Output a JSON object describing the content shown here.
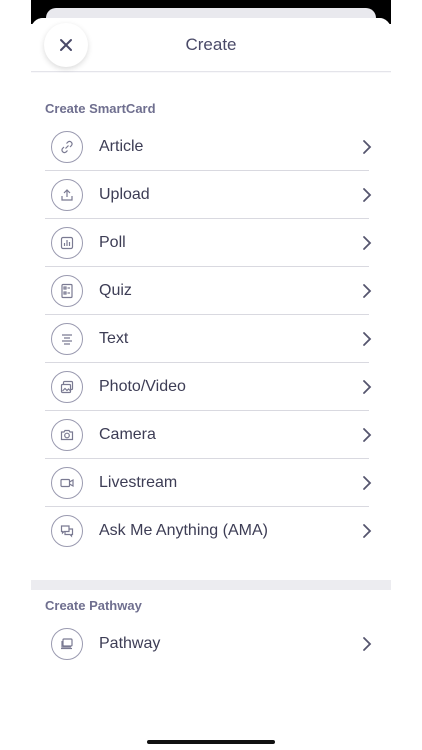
{
  "header": {
    "title": "Create"
  },
  "smartcard_section": {
    "label": "Create SmartCard",
    "items": [
      {
        "label": "Article",
        "icon": "link-icon"
      },
      {
        "label": "Upload",
        "icon": "upload-icon"
      },
      {
        "label": "Poll",
        "icon": "poll-icon"
      },
      {
        "label": "Quiz",
        "icon": "quiz-icon"
      },
      {
        "label": "Text",
        "icon": "text-align-icon"
      },
      {
        "label": "Photo/Video",
        "icon": "photo-video-icon"
      },
      {
        "label": "Camera",
        "icon": "camera-icon"
      },
      {
        "label": "Livestream",
        "icon": "video-camera-icon"
      },
      {
        "label": "Ask Me Anything (AMA)",
        "icon": "chat-bubbles-icon"
      }
    ]
  },
  "pathway_section": {
    "label": "Create Pathway",
    "items": [
      {
        "label": "Pathway",
        "icon": "pathway-icon"
      }
    ]
  },
  "colors": {
    "text_primary": "#3d3d55",
    "text_label": "#6f6f8f",
    "icon_stroke": "#9a9ab0",
    "divider": "#d9d9e0",
    "sheet_background": "#f8f8fa"
  }
}
